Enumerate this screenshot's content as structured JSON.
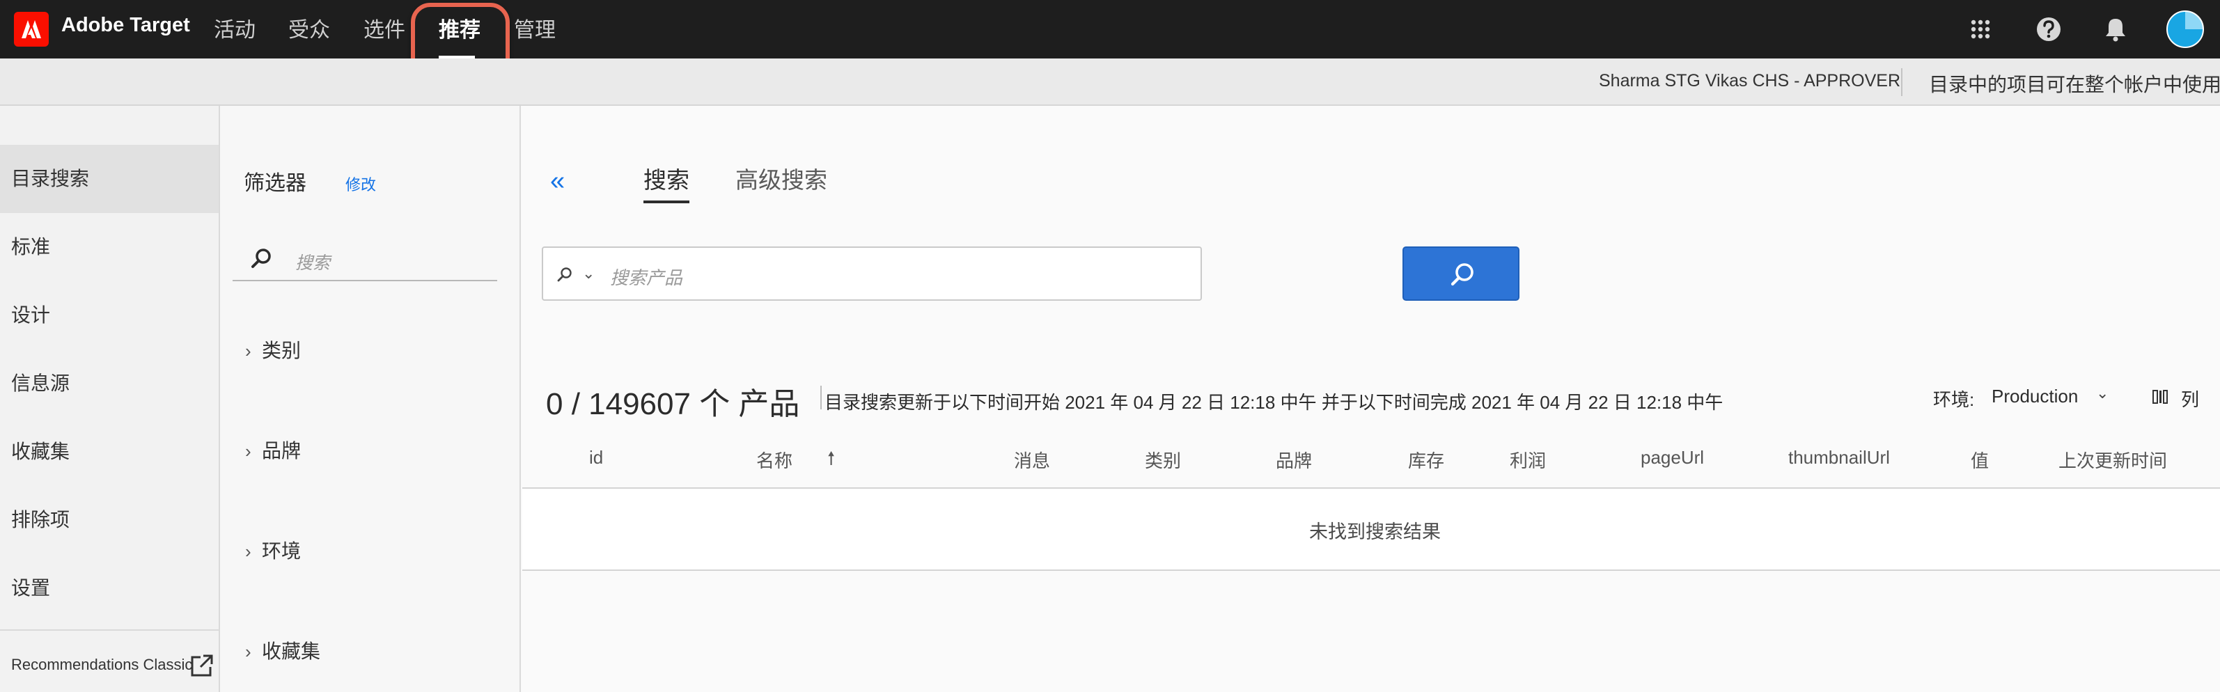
{
  "app": {
    "name": "Adobe Target"
  },
  "topnav": {
    "items": [
      {
        "label": "活动"
      },
      {
        "label": "受众"
      },
      {
        "label": "选件"
      },
      {
        "label": "推荐",
        "active": true
      },
      {
        "label": "管理"
      }
    ],
    "icons": [
      "apps-grid-icon",
      "help-icon",
      "notifications-bell-icon",
      "user-avatar"
    ]
  },
  "subheader": {
    "user": "Sharma STG Vikas CHS - APPROVER",
    "note": "目录中的项目可在整个帐户中使用"
  },
  "sidebar": {
    "items": [
      {
        "label": "目录搜索",
        "active": true
      },
      {
        "label": "标准"
      },
      {
        "label": "设计"
      },
      {
        "label": "信息源"
      },
      {
        "label": "收藏集"
      },
      {
        "label": "排除项"
      },
      {
        "label": "设置"
      }
    ],
    "classic_link": "Recommendations Classic"
  },
  "filters": {
    "title": "筛选器",
    "edit": "修改",
    "search_placeholder": "搜索",
    "facets": [
      {
        "label": "类别"
      },
      {
        "label": "品牌"
      },
      {
        "label": "环境"
      },
      {
        "label": "收藏集"
      }
    ]
  },
  "main": {
    "collapse": "«",
    "tabs": [
      {
        "label": "搜索",
        "active": true
      },
      {
        "label": "高级搜索"
      }
    ],
    "search_placeholder": "搜索产品",
    "count": "0 / 149607 个 产品",
    "update_info": "目录搜索更新于以下时间开始 2021 年 04 月 22 日 12:18 中午 并于以下时间完成 2021 年 04 月 22 日 12:18 中午",
    "environment_label": "环境:",
    "environment_value": "Production",
    "columns_label": "列",
    "table": {
      "columns": [
        "id",
        "名称",
        "消息",
        "类别",
        "品牌",
        "库存",
        "利润",
        "pageUrl",
        "thumbnailUrl",
        "值",
        "上次更新时间"
      ],
      "sorted_column": "名称",
      "sort_direction": "ascending",
      "empty_message": "未找到搜索结果"
    }
  },
  "colors": {
    "topnav_bg": "#1e1e1e",
    "brand_red": "#fa0f00",
    "accent_blue": "#2d74d6",
    "link_blue": "#1473e6",
    "highlight_ring": "#e8644f"
  }
}
